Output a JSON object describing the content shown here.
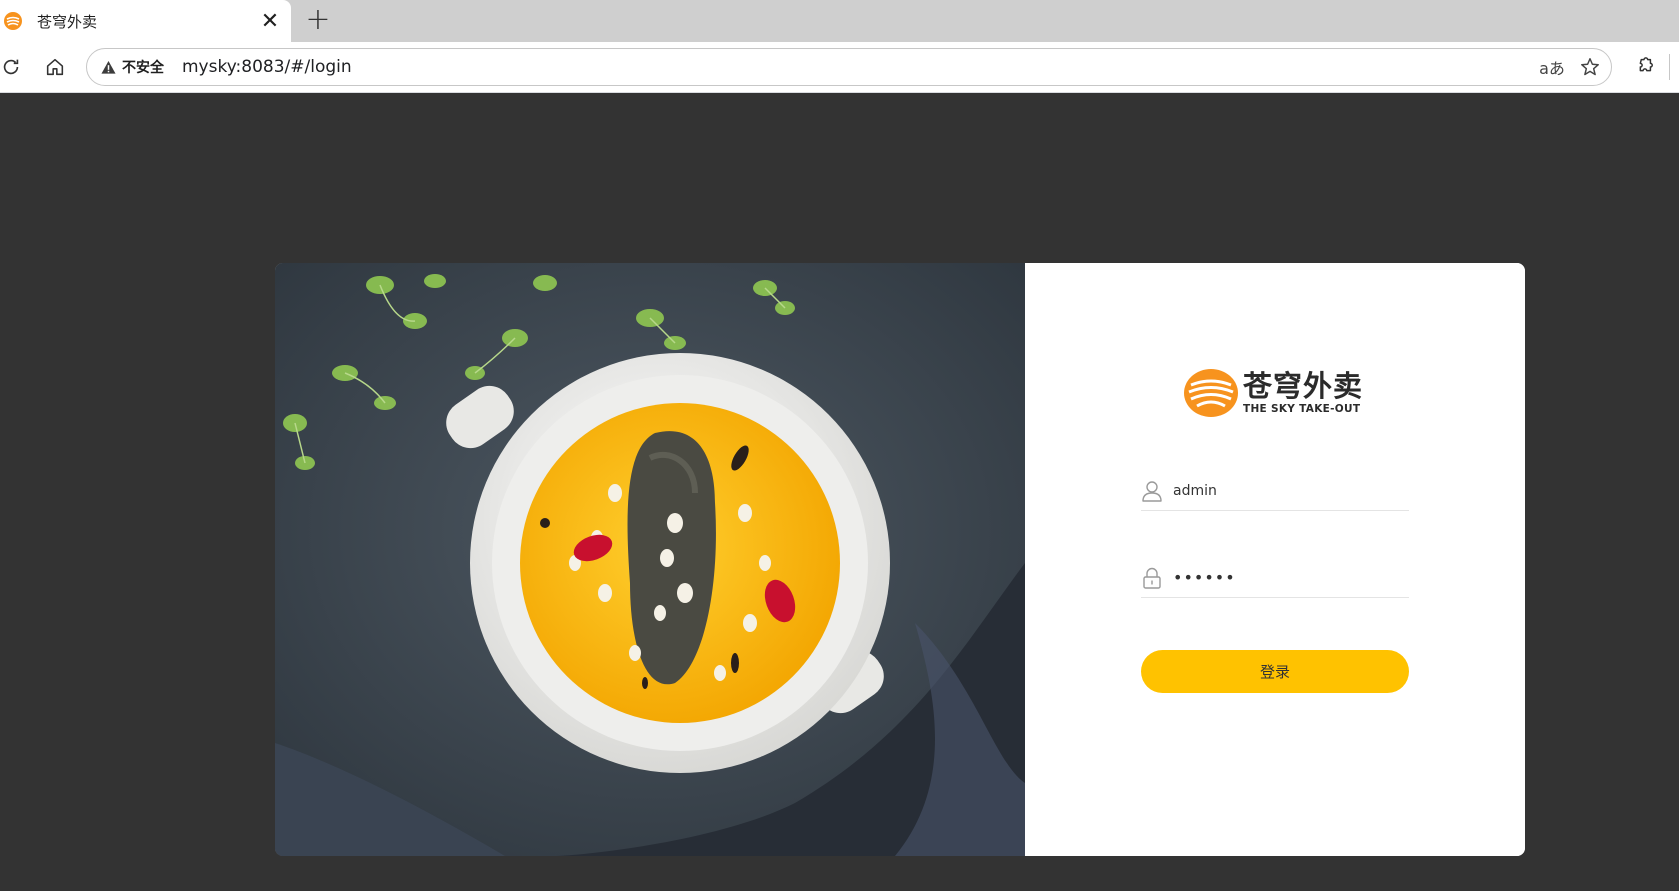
{
  "browser": {
    "tab": {
      "title": "苍穹外卖",
      "close_glyph": "✕"
    },
    "new_tab_glyph": "+",
    "address": {
      "security_label": "不安全",
      "url": "mysky:8083/#/login"
    },
    "icons": {
      "reload": "reload-icon",
      "home": "home-icon",
      "warning": "warning-icon",
      "translate": "translate-icon",
      "favorite": "star-icon",
      "extensions": "puzzle-icon"
    },
    "translate_glyph": "aあ"
  },
  "login": {
    "logo": {
      "title_cn": "苍穹外卖",
      "title_en": "THE SKY TAKE-OUT"
    },
    "username": {
      "value": "admin",
      "icon": "user-icon"
    },
    "password": {
      "value": "123456",
      "icon": "lock-icon"
    },
    "submit_label": "登录"
  },
  "colors": {
    "page_bg": "#333333",
    "accent": "#ffc200",
    "logo_orange": "#f7931e"
  }
}
